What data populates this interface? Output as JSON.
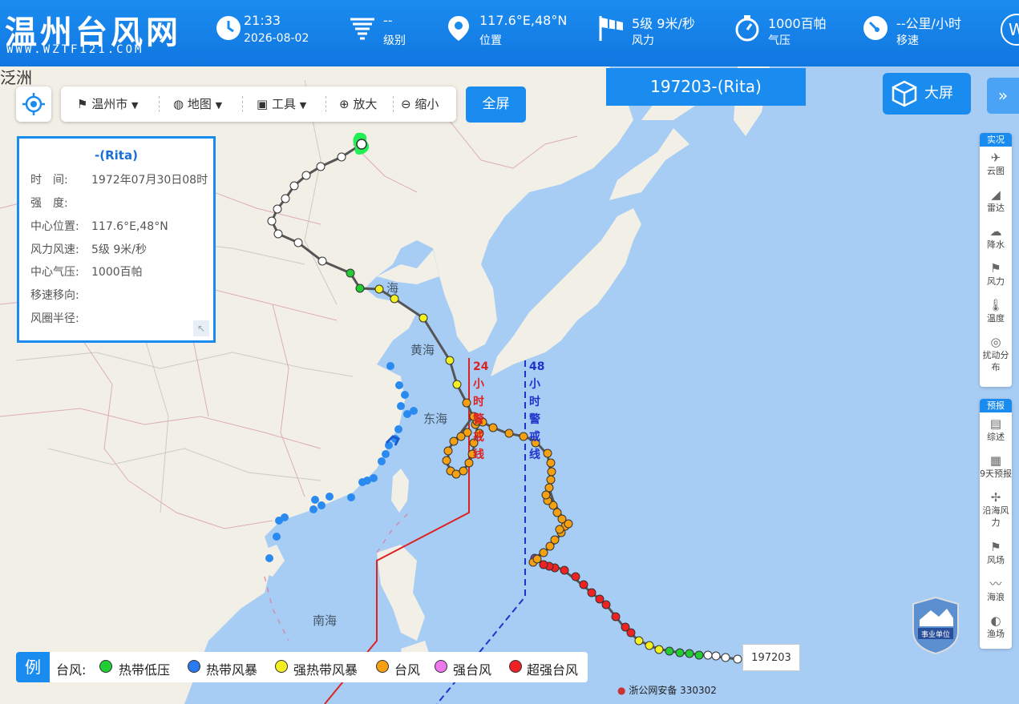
{
  "header": {
    "site_title": "温州台风网",
    "site_url": "WWW.WZTF121.COM",
    "time": "21:33",
    "date": "2026-08-02",
    "level_value": "--",
    "level_label": "级别",
    "position_value": "117.6°E,48°N",
    "position_label": "位置",
    "wind_value": "5级 9米/秒",
    "wind_label": "风力",
    "pressure_value": "1000百帕",
    "pressure_label": "气压",
    "speed_value": "--公里/小时",
    "speed_label": "移速",
    "w_icon": "W"
  },
  "toolbar": {
    "city": "温州市",
    "map": "地图",
    "tools": "工具",
    "zoom_in": "放大",
    "zoom_out": "缩小",
    "fullscreen": "全屏"
  },
  "typhoon_title": "197203-(Rita)",
  "bigscreen": "大屏",
  "collapse": "»",
  "info_panel": {
    "title": "-(Rita)",
    "time_label": "时　间:",
    "time_value": "1972年07月30日08时",
    "strength_label": "强　度:",
    "strength_value": "",
    "center_label": "中心位置:",
    "center_value": "117.6°E,48°N",
    "wind_label": "风力风速:",
    "wind_value": "5级 9米/秒",
    "pressure_label": "中心气压:",
    "pressure_value": "1000百帕",
    "move_label": "移速移向:",
    "move_value": "",
    "radius_label": "风圈半径:",
    "radius_value": ""
  },
  "map_labels": {
    "huanghai": "黄海",
    "donghai": "东海",
    "nanhai": "南海",
    "bohai": "海",
    "corner_text": "泛洲",
    "line24": [
      "24",
      "小",
      "时",
      "警",
      "戒",
      "线"
    ],
    "line48": [
      "48",
      "小",
      "时",
      "警",
      "戒",
      "线"
    ],
    "end_label": "197203"
  },
  "sidebar_live": {
    "header": "实况",
    "items": [
      {
        "label": "云图",
        "icon": "satellite-icon"
      },
      {
        "label": "雷达",
        "icon": "radar-icon"
      },
      {
        "label": "降水",
        "icon": "rain-icon"
      },
      {
        "label": "风力",
        "icon": "wind-flag-icon"
      },
      {
        "label": "温度",
        "icon": "thermometer-icon"
      },
      {
        "label": "扰动分布",
        "icon": "disturbance-icon"
      }
    ]
  },
  "sidebar_forecast": {
    "header": "预报",
    "items": [
      {
        "label": "综述",
        "icon": "summary-icon"
      },
      {
        "label": "9天预报",
        "icon": "forecast-doc-icon"
      },
      {
        "label": "沿海风力",
        "icon": "coastal-wind-icon"
      },
      {
        "label": "风场",
        "icon": "wind-field-icon"
      },
      {
        "label": "海浪",
        "icon": "wave-icon"
      },
      {
        "label": "渔场",
        "icon": "fishery-icon"
      }
    ]
  },
  "legend": {
    "tag": "例",
    "prefix": "台风:",
    "items": [
      {
        "label": "热带低压",
        "color": "#22cc33"
      },
      {
        "label": "热带风暴",
        "color": "#2a7bf0"
      },
      {
        "label": "强热带风暴",
        "color": "#f5f020"
      },
      {
        "label": "台风",
        "color": "#f5a011"
      },
      {
        "label": "强台风",
        "color": "#ee77ee"
      },
      {
        "label": "超强台风",
        "color": "#ee2222"
      }
    ]
  },
  "police": "浙公网安备 330302",
  "badge_text": "事业单位",
  "colors": {
    "brand": "#1a8cf0",
    "sea": "#a8cdf5",
    "land": "#f2efe6",
    "warn24": "#dd2222",
    "warn48": "#1f33cc"
  }
}
